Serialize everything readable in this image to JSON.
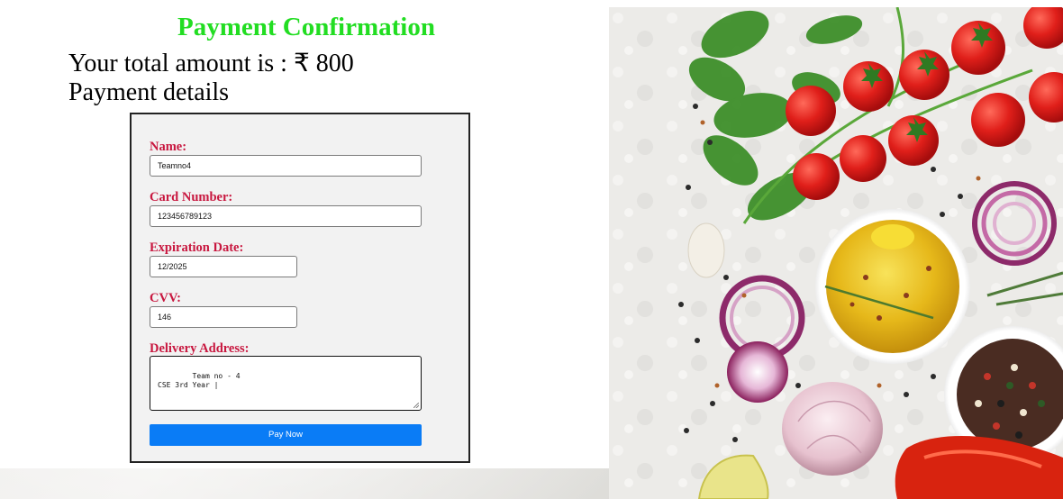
{
  "page": {
    "title": "Payment Confirmation",
    "total_line": "Your total amount is : ₹ 800",
    "details_heading": "Payment details"
  },
  "form": {
    "name_label": "Name:",
    "name_value": "Teamno4",
    "card_label": "Card Number:",
    "card_value": "123456789123",
    "expiry_label": "Expiration Date:",
    "expiry_value": "12/2025",
    "cvv_label": "CVV:",
    "cvv_value": "146",
    "address_label": "Delivery Address:",
    "address_value": "Team no - 4\nCSE 3rd Year |",
    "pay_button_label": "Pay Now"
  },
  "colors": {
    "title": "#22dd22",
    "label": "#c8173f",
    "button": "#0a7cf6"
  },
  "image": {
    "description_icon": "food-ingredients-photo"
  }
}
